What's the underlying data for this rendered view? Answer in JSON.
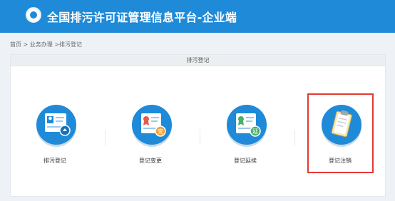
{
  "header": {
    "title": "全国排污许可证管理信息平台-企业端"
  },
  "breadcrumb": {
    "text": "首页 > 业务办理 >排污登记"
  },
  "panel": {
    "title": "排污登记"
  },
  "tiles": [
    {
      "label": "排污登记",
      "icon": "registration-card-icon"
    },
    {
      "label": "登记变更",
      "icon": "certificate-change-icon"
    },
    {
      "label": "登记延续",
      "icon": "certificate-extend-icon"
    },
    {
      "label": "登记注销",
      "icon": "clipboard-cancel-icon"
    }
  ],
  "colors": {
    "brand": "#1f8ad8",
    "highlight": "#e53935"
  }
}
